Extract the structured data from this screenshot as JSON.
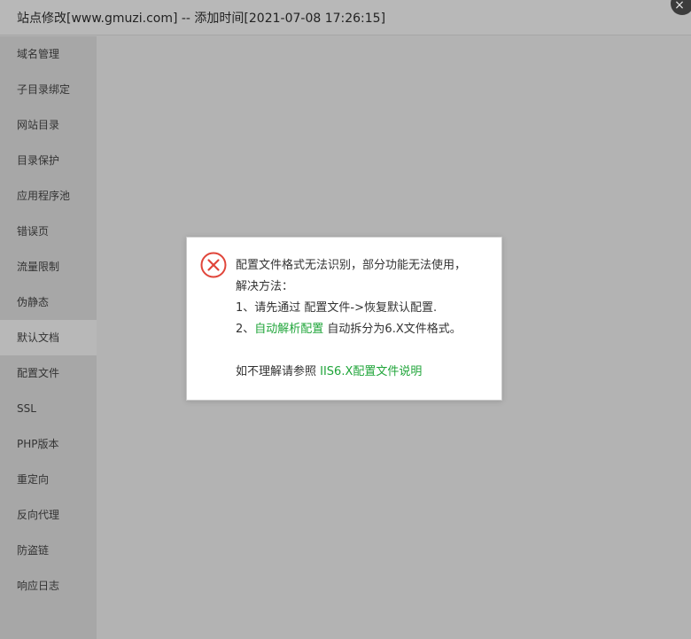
{
  "window": {
    "title": "站点修改[www.gmuzi.com] -- 添加时间[2021-07-08 17:26:15]",
    "close_symbol": "×"
  },
  "sidebar": {
    "items": [
      {
        "label": "域名管理"
      },
      {
        "label": "子目录绑定"
      },
      {
        "label": "网站目录"
      },
      {
        "label": "目录保护"
      },
      {
        "label": "应用程序池"
      },
      {
        "label": "错误页"
      },
      {
        "label": "流量限制"
      },
      {
        "label": "伪静态"
      },
      {
        "label": "默认文档",
        "active": true
      },
      {
        "label": "配置文件"
      },
      {
        "label": "SSL"
      },
      {
        "label": "PHP版本"
      },
      {
        "label": "重定向"
      },
      {
        "label": "反向代理"
      },
      {
        "label": "防盗链"
      },
      {
        "label": "响应日志"
      }
    ]
  },
  "dialog": {
    "icon": "error-icon",
    "line1": "配置文件格式无法识别，部分功能无法使用，",
    "line2": "解决方法：",
    "line3": "1、请先通过 配置文件->恢复默认配置.",
    "line4_prefix": "2、",
    "line4_link": "自动解析配置",
    "line4_suffix": " 自动拆分为6.X文件格式。",
    "line5_prefix": "如不理解请参照 ",
    "line5_link": "IIS6.X配置文件说明"
  },
  "colors": {
    "link": "#20a53a",
    "error": "#e0453a",
    "overlay": "#b3b3b3"
  }
}
